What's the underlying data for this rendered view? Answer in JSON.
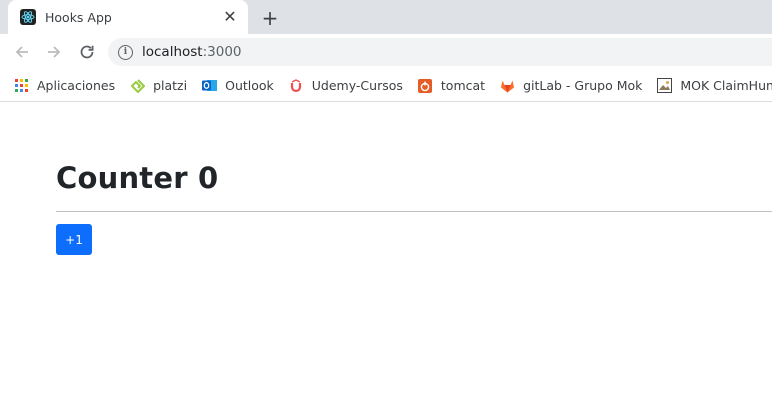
{
  "browser": {
    "tab": {
      "title": "Hooks App",
      "favicon": "react-logo-icon",
      "close_glyph": "✕"
    },
    "new_tab_glyph": "+",
    "address": {
      "host": "localhost",
      "port": ":3000"
    },
    "bookmarks": [
      {
        "label": "Aplicaciones",
        "icon": "apps-grid-icon"
      },
      {
        "label": "platzi",
        "icon": "platzi-icon",
        "color": "#98ca3f"
      },
      {
        "label": "Outlook",
        "icon": "outlook-icon",
        "color": "#0a64c8"
      },
      {
        "label": "Udemy-Cursos",
        "icon": "udemy-icon",
        "color": "#ec5252"
      },
      {
        "label": "tomcat",
        "icon": "tomcat-icon",
        "color": "#e55d26"
      },
      {
        "label": "gitLab - Grupo Mok",
        "icon": "gitlab-icon",
        "color": "#fc6d26"
      },
      {
        "label": "MOK ClaimHuntin...",
        "icon": "image-icon"
      }
    ]
  },
  "page": {
    "title": "Counter 0",
    "button_label": "+1",
    "accent": "#0d6efd"
  }
}
